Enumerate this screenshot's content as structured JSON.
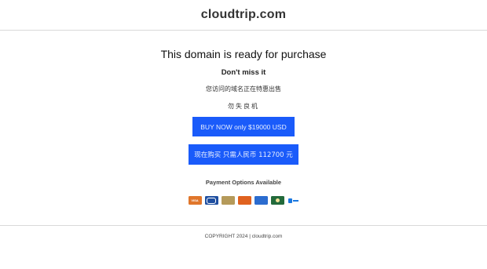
{
  "header": {
    "site_title": "cloudtrip.com"
  },
  "main": {
    "headline": "This domain is ready for purchase",
    "subheadline": "Don't miss it",
    "chinese_notice": "您访问的域名正在特惠出售",
    "chinese_slogan": "勿失良机",
    "buy_usd_label": "BUY NOW only $19000 USD",
    "buy_cny_label": "现在购买 只需人民币 112700 元"
  },
  "payment": {
    "title": "Payment Options Available",
    "methods": [
      {
        "name": "VISA",
        "icon": "visa-icon"
      },
      {
        "name": "Diners Club",
        "icon": "diners-icon"
      },
      {
        "name": "American Express",
        "icon": "amex-icon"
      },
      {
        "name": "Discover",
        "icon": "discover-icon"
      },
      {
        "name": "PayPal",
        "icon": "paypal-icon"
      },
      {
        "name": "Bank Transfer",
        "icon": "bank-icon"
      },
      {
        "name": "Alipay",
        "icon": "alipay-icon"
      }
    ]
  },
  "footer": {
    "copyright": "COPYRIGHT 2024 | cloudtrip.com"
  },
  "colors": {
    "button_bg": "#1a5bfa",
    "divider": "#d9d9d9"
  }
}
